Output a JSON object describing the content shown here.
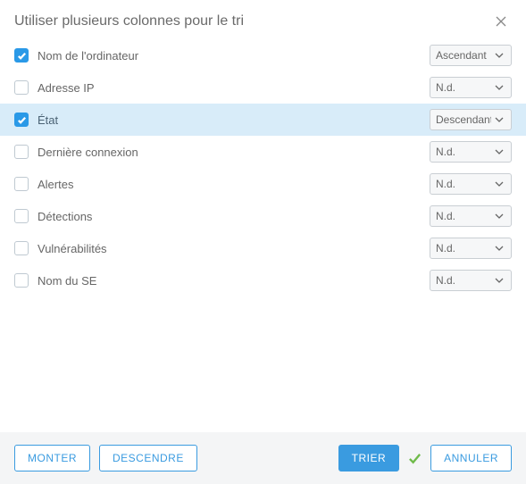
{
  "header": {
    "title": "Utiliser plusieurs colonnes pour le tri"
  },
  "rows": [
    {
      "label": "Nom de l'ordinateur",
      "checked": true,
      "order": "Ascendant",
      "selected": false
    },
    {
      "label": "Adresse IP",
      "checked": false,
      "order": "N.d.",
      "selected": false
    },
    {
      "label": "État",
      "checked": true,
      "order": "Descendant",
      "selected": true
    },
    {
      "label": "Dernière connexion",
      "checked": false,
      "order": "N.d.",
      "selected": false
    },
    {
      "label": "Alertes",
      "checked": false,
      "order": "N.d.",
      "selected": false
    },
    {
      "label": "Détections",
      "checked": false,
      "order": "N.d.",
      "selected": false
    },
    {
      "label": "Vulnérabilités",
      "checked": false,
      "order": "N.d.",
      "selected": false
    },
    {
      "label": "Nom du SE",
      "checked": false,
      "order": "N.d.",
      "selected": false
    }
  ],
  "order_options": [
    "Ascendant",
    "Descendant",
    "N.d."
  ],
  "footer": {
    "move_up_label": "MONTER",
    "move_down_label": "DESCENDRE",
    "sort_label": "TRIER",
    "cancel_label": "ANNULER"
  }
}
